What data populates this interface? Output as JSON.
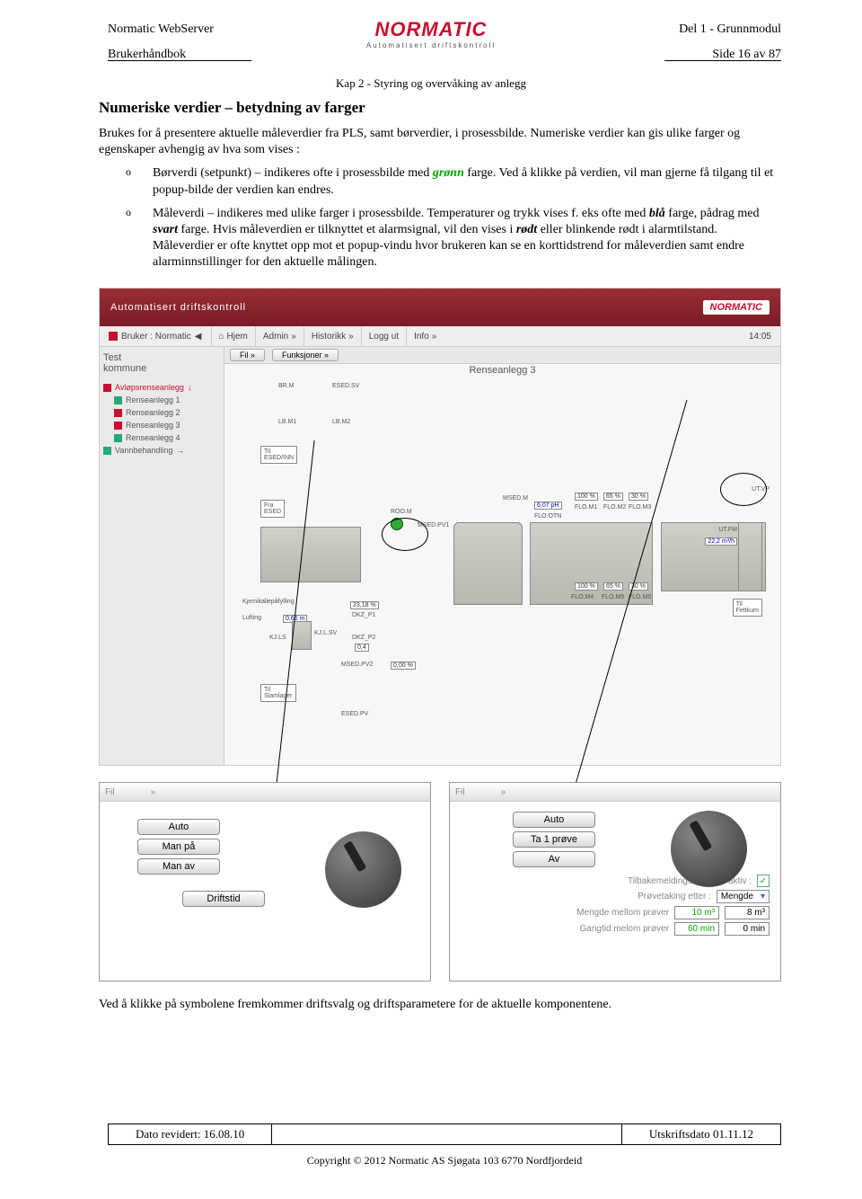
{
  "hdr": {
    "left1": "Normatic WebServer",
    "left2": "Brukerhåndbok",
    "right1": "Del 1 - Grunnmodul",
    "right2": "Side 16 av 87",
    "logo": "NORMATIC",
    "logoSub": "Automatisert driftskontroll",
    "kap": "Kap 2 - Styring og overvåking av anlegg"
  },
  "heading": "Numeriske verdier – betydning av farger",
  "intro": "Brukes for å presentere aktuelle måleverdier fra PLS, samt børverdier, i prosessbilde. Numeriske verdier kan gis ulike farger og egenskaper avhengig av hva som vises :",
  "bullet1a": "Børverdi (setpunkt) – indikeres ofte i prosessbilde med ",
  "bullet1b": "grønn",
  "bullet1c": " farge. Ved å klikke på verdien, vil man gjerne få tilgang til et popup-bilde der verdien kan endres.",
  "bullet2a": "Måleverdi – indikeres med ulike farger i prosessbilde. Temperaturer og trykk vises f. eks ofte med ",
  "bullet2b": "blå",
  "bullet2c": " farge, pådrag med ",
  "bullet2d": "svart",
  "bullet2e": " farge. Hvis måleverdien er tilknyttet et alarmsignal, vil den vises i ",
  "bullet2f": "rødt",
  "bullet2g": " eller blinkende rødt i alarmtilstand. Måleverdier er ofte knyttet opp mot et popup-vindu hvor brukeren kan se en korttidstrend for måleverdien samt endre alarminnstillinger for den aktuelle målingen.",
  "app": {
    "title": "Automatisert driftskontroll",
    "logo": "NORMATIC",
    "user": "Bruker : Normatic",
    "nav": [
      "Hjem",
      "Admin",
      "Historikk",
      "Logg ut",
      "Info"
    ],
    "time": "14:05"
  },
  "sb": {
    "h1": "Test",
    "h2": "kommune",
    "g0": "Avløpsrenseanlegg",
    "items": [
      "Renseanlegg 1",
      "Renseanlegg 2",
      "Renseanlegg 3",
      "Renseanlegg 4"
    ],
    "g1": "Vannbehandling"
  },
  "main": {
    "fil": "Fil",
    "funk": "Funksjoner",
    "title": "Renseanlegg 3"
  },
  "diag": {
    "brm": "BR.M",
    "esedsv": "ESED.SV",
    "lbm1": "LB.M1",
    "lbm2": "LB.M2",
    "box1": "Til\nESED/INN",
    "box2": "Fra\nESED",
    "kjem": "Kjemikaliepåfylling",
    "lufting": "Lufting",
    "p1": "0,66 m",
    "kjls": "KJ.LS",
    "kjl": "KJ.L.SV",
    "d1": "23,18 %",
    "dkzp1": "DKZ_P1",
    "dkzp2": "DKZ_P2",
    "dkzp2v": "0,4",
    "msedpv2": "MSED.PV2",
    "msedpv2v": "0,00 %",
    "slam": "Til\nSlamlager",
    "esedpv": "ESED.PV",
    "room": "ROO.M",
    "msedpv1": "MSED.PV1",
    "msedm": "MSED.M",
    "msedmv": "6,07 pH",
    "flootn": "FLO.OTN",
    "pct": [
      "100 %",
      "65 %",
      "30 %"
    ],
    "flom": [
      "FLO.M4",
      "FLO.M5",
      "FLO.M6"
    ],
    "flom2": [
      "FLO.M1",
      "FLO.M2",
      "FLO.M3"
    ],
    "utvp": "UT.VP",
    "utfm": "UT.FM",
    "utfmv": "22,2 m³/h",
    "fett": "Til\nFettkum"
  },
  "pop1": {
    "fil": "Fil",
    "b1": "Auto",
    "b2": "Man på",
    "b3": "Man av",
    "b4": "Driftstid"
  },
  "pop2": {
    "fil": "Fil",
    "b1": "Auto",
    "b2": "Ta 1 prøve",
    "b3": "Av",
    "r1": "Tilbakemeldingsfunksjon aktiv :",
    "r2": "Prøvetaking etter :",
    "sel": "Mengde",
    "r3": "Mengde mellom prøver",
    "v3a": "10 m³",
    "v3b": "8 m³",
    "r4": "Gangtid melom prøver",
    "v4a": "60 min",
    "v4b": "0 min"
  },
  "caption": "Ved å klikke på symbolene fremkommer driftsvalg og driftsparametere for de aktuelle komponentene.",
  "ftr": {
    "l": "Dato revidert: 16.08.10",
    "r": "Utskriftsdato 01.11.12",
    "c": "Copyright © 2012  Normatic AS Sjøgata 103 6770 Nordfjordeid"
  }
}
